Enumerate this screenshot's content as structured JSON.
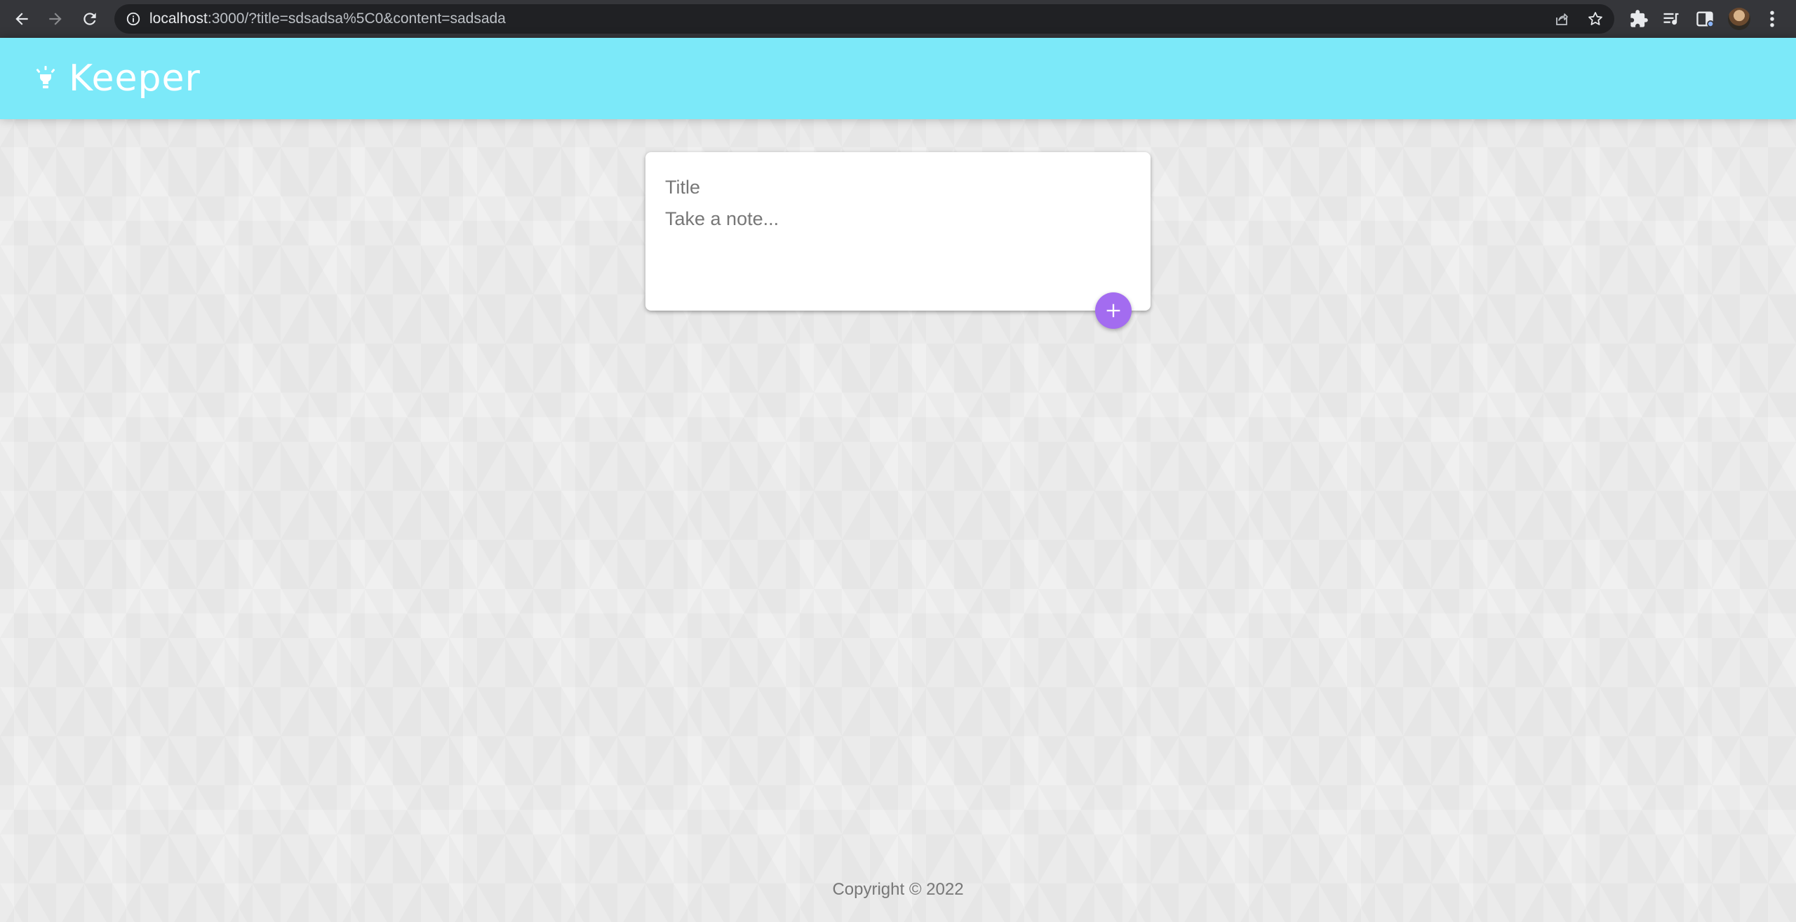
{
  "browser": {
    "url_host": "localhost",
    "url_rest": ":3000/?title=sdsadsa%5C0&content=sadsada",
    "icons": {
      "back": "arrow-left-icon",
      "forward": "arrow-right-icon",
      "reload": "reload-icon",
      "site_info": "info-icon",
      "share": "share-icon",
      "bookmark": "star-icon",
      "extensions": "puzzle-icon",
      "reading_list": "reading-list-icon",
      "side_panel": "side-panel-icon",
      "menu": "kebab-menu-icon"
    }
  },
  "header": {
    "app_name": "Keeper",
    "logo_icon": "lightbulb-icon",
    "background_color": "#7ce9f9"
  },
  "composer": {
    "title_placeholder": "Title",
    "content_placeholder": "Take a note...",
    "add_icon": "plus-icon",
    "add_button_color": "#a36cf0"
  },
  "footer": {
    "copyright": "Copyright © 2022"
  }
}
